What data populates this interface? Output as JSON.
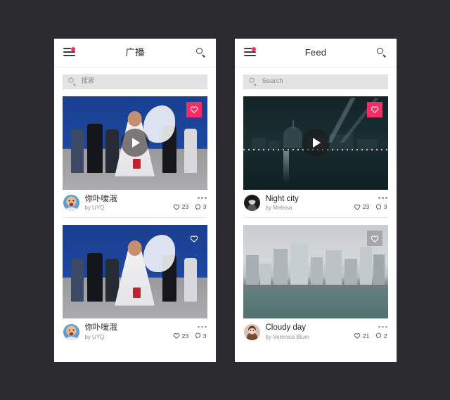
{
  "theme": {
    "page_background": "#2c2c30",
    "phone_background": "#ffffff",
    "accent_pink": "#fa2c63",
    "search_field_background": "#e3e3e3",
    "muted_text": "#8f8f8f"
  },
  "phones": [
    {
      "name": "left-phone",
      "topbar": {
        "menu_icon": "hamburger-menu-icon",
        "menu_badge": "notification-dot",
        "title": "广播",
        "title_is_cjk": true,
        "search_icon": "search-icon"
      },
      "search": {
        "icon": "search-icon",
        "placeholder": "搜索",
        "value": ""
      },
      "posts": [
        {
          "art": "art-street",
          "media_type": "video",
          "play_icon": "play-icon",
          "like_button": {
            "icon": "heart-icon",
            "state": "liked",
            "style": "filled"
          },
          "avatar": "avatar-uyq",
          "title": "你卟嗳涐",
          "author": "by UYQ",
          "more_icon": "more-options-icon",
          "likes": "23",
          "comments": "3",
          "like_icon": "heart-outline-icon",
          "comment_icon": "comment-icon"
        },
        {
          "art": "art-street",
          "media_type": "image",
          "play_icon": "",
          "like_button": {
            "icon": "heart-icon",
            "state": "unliked",
            "style": "ghost"
          },
          "avatar": "avatar-uyq",
          "title": "你卟嗳涐",
          "author": "by UYQ",
          "more_icon": "more-options-icon",
          "likes": "23",
          "comments": "3",
          "like_icon": "heart-outline-icon",
          "comment_icon": "comment-icon"
        }
      ]
    },
    {
      "name": "right-phone",
      "topbar": {
        "menu_icon": "hamburger-menu-icon",
        "menu_badge": "notification-dot",
        "title": "Feed",
        "title_is_cjk": false,
        "search_icon": "search-icon"
      },
      "search": {
        "icon": "search-icon",
        "placeholder": "Search",
        "value": ""
      },
      "posts": [
        {
          "art": "art-night",
          "media_type": "video",
          "play_icon": "play-icon",
          "like_button": {
            "icon": "heart-icon",
            "state": "liked",
            "style": "filled"
          },
          "avatar": "avatar-melissa",
          "title": "Night city",
          "author": "by Melissa",
          "more_icon": "more-options-icon",
          "likes": "23",
          "comments": "3",
          "like_icon": "heart-outline-icon",
          "comment_icon": "comment-icon"
        },
        {
          "art": "art-cloudy",
          "media_type": "image",
          "play_icon": "",
          "like_button": {
            "icon": "heart-icon",
            "state": "unliked",
            "style": "grey"
          },
          "avatar": "avatar-veronica",
          "title": "Cloudy day",
          "author": "by Veronica Blum",
          "more_icon": "more-options-icon",
          "likes": "21",
          "comments": "2",
          "like_icon": "heart-outline-icon",
          "comment_icon": "comment-icon"
        }
      ]
    }
  ]
}
